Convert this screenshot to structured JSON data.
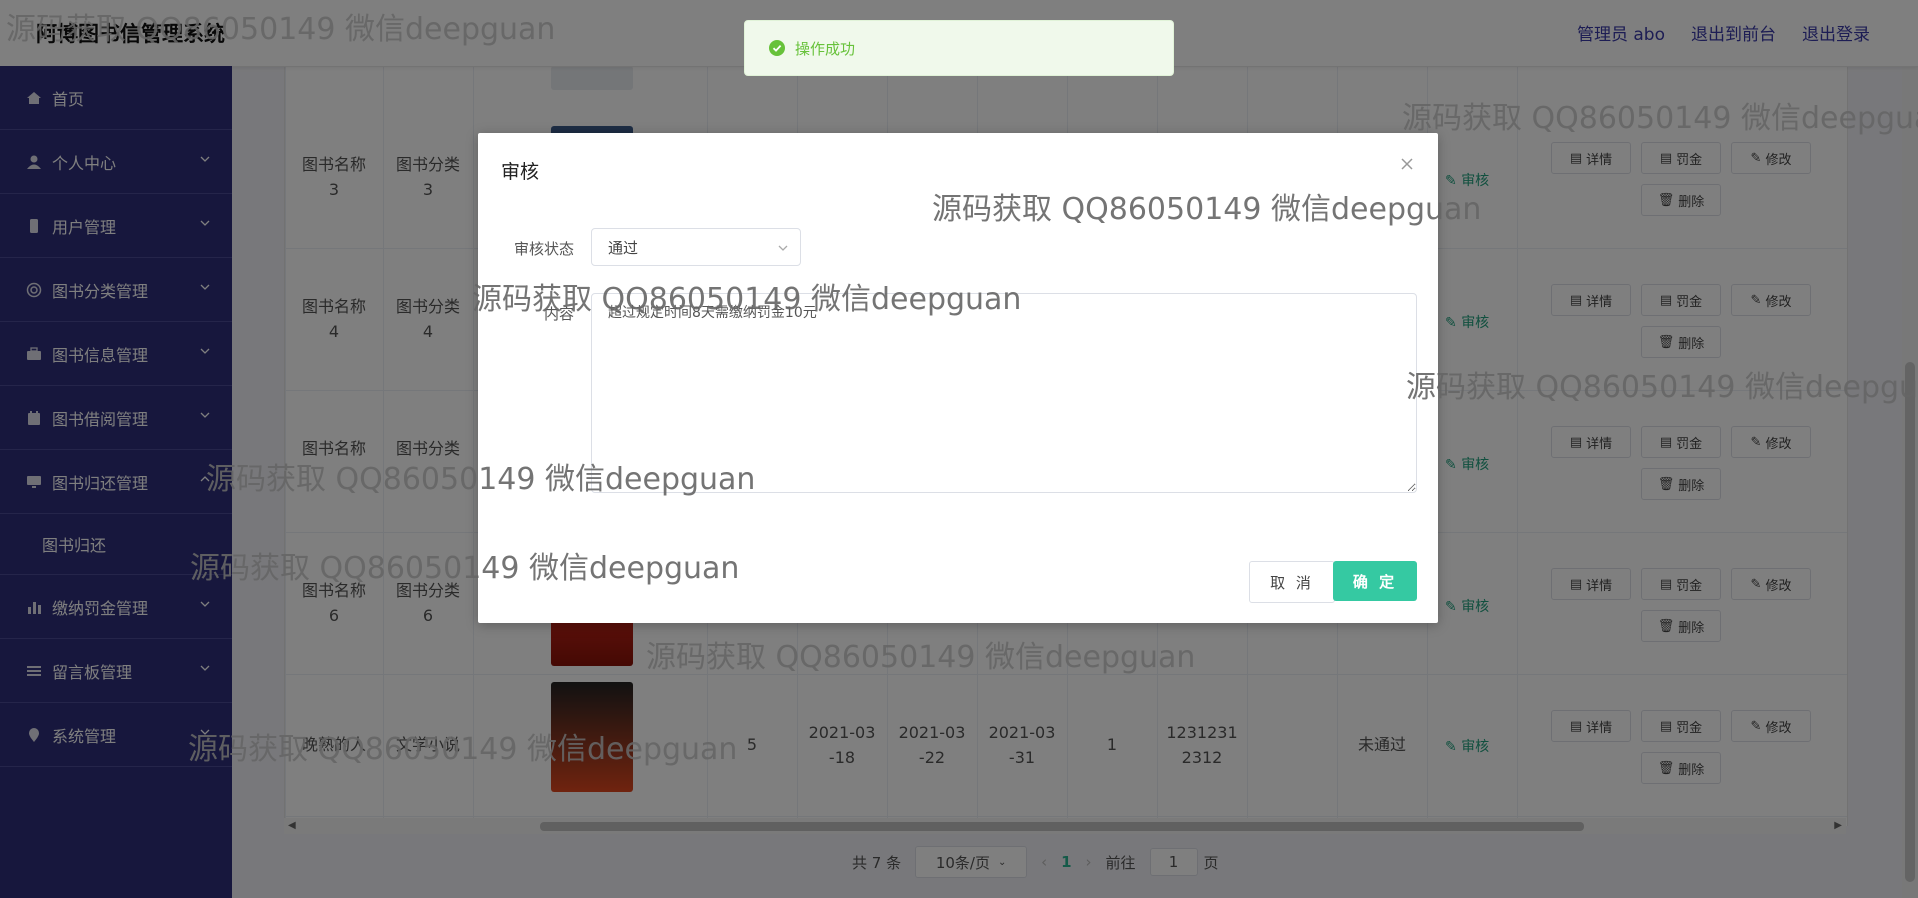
{
  "app": {
    "title": "阿博图书信管理系统",
    "header_links": [
      "管理员 abo",
      "退出到前台",
      "退出登录"
    ]
  },
  "sidebar": {
    "items": [
      {
        "label": "首页",
        "icon": "home-icon",
        "expandable": false
      },
      {
        "label": "个人中心",
        "icon": "user-icon",
        "expandable": true
      },
      {
        "label": "用户管理",
        "icon": "phone-icon",
        "expandable": true
      },
      {
        "label": "图书分类管理",
        "icon": "target-icon",
        "expandable": true
      },
      {
        "label": "图书信息管理",
        "icon": "briefcase-icon",
        "expandable": true
      },
      {
        "label": "图书借阅管理",
        "icon": "calendar-icon",
        "expandable": true
      },
      {
        "label": "图书归还管理",
        "icon": "monitor-icon",
        "expandable": true,
        "expanded": true,
        "children": [
          "图书归还"
        ]
      },
      {
        "label": "缴纳罚金管理",
        "icon": "bar-chart-icon",
        "expandable": true
      },
      {
        "label": "留言板管理",
        "icon": "list-icon",
        "expandable": true
      },
      {
        "label": "系统管理",
        "icon": "location-icon",
        "expandable": true
      }
    ]
  },
  "table": {
    "rows": [
      {
        "name": "图书名称\n3",
        "category": "图书分类\n3"
      },
      {
        "name": "图书名称\n4",
        "category": "图书分类\n4"
      },
      {
        "name": "图书名称",
        "category": "图书分类"
      },
      {
        "name": "图书名称\n6",
        "category": "图书分类\n6"
      },
      {
        "name": "晚熟的人",
        "category": "文学小说",
        "qty": "5",
        "date1": "2021-03\n-18",
        "date2": "2021-03\n-22",
        "date3": "2021-03\n-31",
        "days": "1",
        "account": "1231231\n2312",
        "status": "未通过"
      }
    ],
    "actions": {
      "detail": "详情",
      "fine": "罚金",
      "edit": "修改",
      "delete": "删除",
      "audit": "审核"
    }
  },
  "pagination": {
    "total": "共 7 条",
    "page_size": "10条/页",
    "current_page": "1",
    "goto_label": "前往",
    "goto_value": "1",
    "page_suffix": "页"
  },
  "toast": {
    "message": "操作成功"
  },
  "dialog": {
    "title": "审核",
    "status_label": "审核状态",
    "status_value": "通过",
    "content_label": "内容",
    "content_value": "超过规定时间8天需缴纳罚金10元",
    "cancel_label": "取 消",
    "ok_label": "确 定"
  },
  "watermarks": [
    "源码获取 QQ86050149 微信deepguan",
    "源码获取 QQ86050149 微信deepgua",
    "源码获取 QQ86050149 微信deepguan",
    "源码获取 QQ86050149 微信deepguan",
    "源码获取 QQ86050149 微信deepgua",
    "源码获取 QQ86050149 微信deepguan",
    "源码获取 QQ86050149 微信deepguan",
    "源码获取 QQ86050149 微信deepguan",
    "源码获取 QQ86050149 微信deepguan"
  ]
}
